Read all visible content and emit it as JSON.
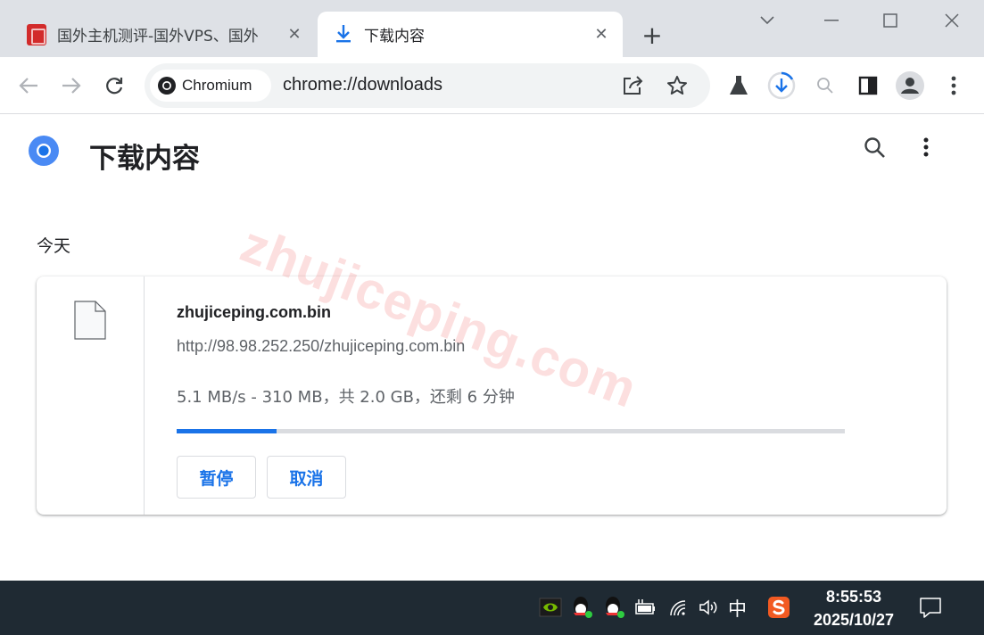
{
  "tabs": [
    {
      "title": "国外主机测评-国外VPS、国外",
      "icon": "site-favicon"
    },
    {
      "title": "下载内容",
      "icon": "download-icon"
    }
  ],
  "window": {
    "minimize_icon": "minimize-icon",
    "maximize_icon": "maximize-icon",
    "close_icon": "close-icon"
  },
  "toolbar": {
    "chip_label": "Chromium",
    "url": "chrome://downloads"
  },
  "page": {
    "title": "下载内容",
    "section": "今天"
  },
  "download": {
    "file_name": "zhujiceping.com.bin",
    "url": "http://98.98.252.250/zhujiceping.com.bin",
    "status": "5.1 MB/s - 310 MB，共 2.0 GB，还剩 6 分钟",
    "progress": 0.15,
    "pause_label": "暂停",
    "cancel_label": "取消"
  },
  "watermark": "zhujiceping.com",
  "taskbar": {
    "ime": "中",
    "time": "8:55:53",
    "date": "2025/10/27"
  },
  "colors": {
    "accent": "#1a73e8",
    "tabstrip": "#dee1e6",
    "taskbar": "#1f2a33"
  }
}
